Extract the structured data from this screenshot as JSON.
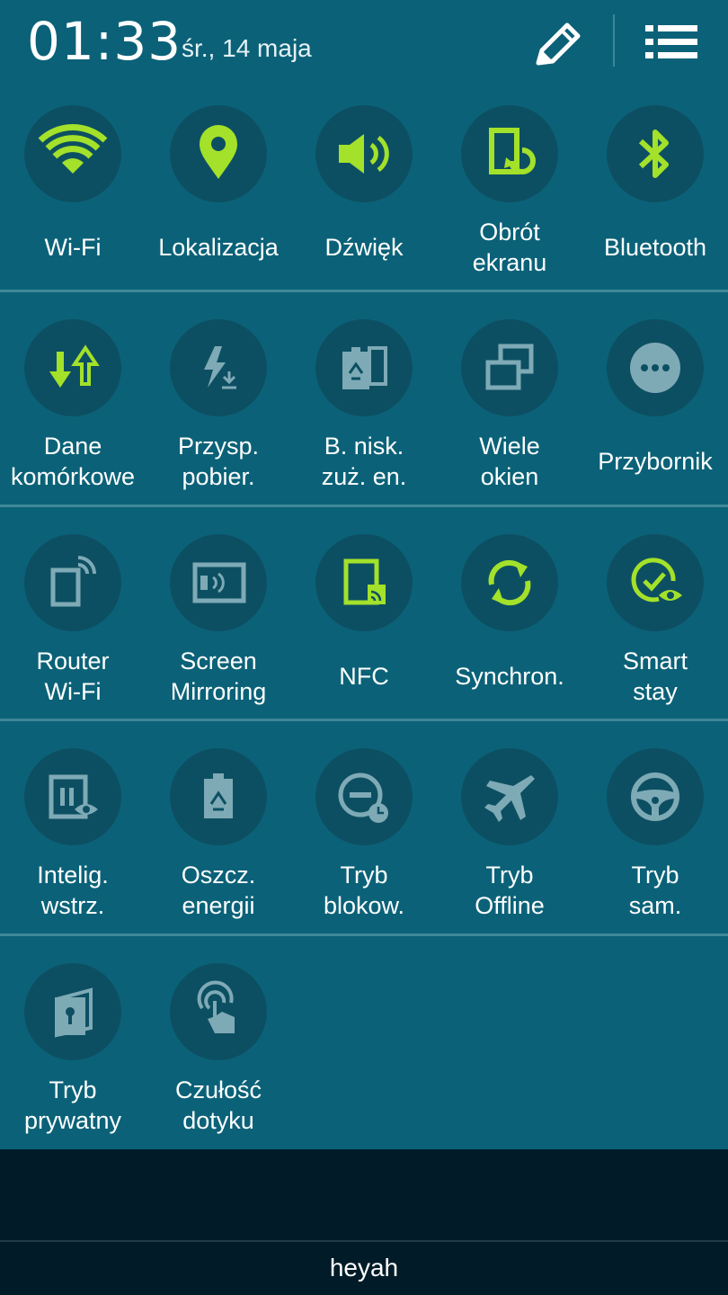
{
  "status": {
    "time": "01:33",
    "date": "śr., 14 maja"
  },
  "header": {
    "edit_icon": "pencil-icon",
    "menu_icon": "list-icon"
  },
  "colors": {
    "panel": "#0b6278",
    "circle": "#0d4f62",
    "active": "#a3e12a",
    "inactive": "#7eaab6"
  },
  "tiles": [
    {
      "label": "Wi-Fi",
      "icon": "wifi-icon",
      "active": true
    },
    {
      "label": "Lokalizacja",
      "icon": "location-pin-icon",
      "active": true
    },
    {
      "label": "Dźwięk",
      "icon": "speaker-icon",
      "active": true
    },
    {
      "label": "Obrót\nekranu",
      "icon": "screen-rotation-icon",
      "active": true
    },
    {
      "label": "Bluetooth",
      "icon": "bluetooth-icon",
      "active": true
    },
    {
      "label": "Dane\nkomórkowe",
      "icon": "mobile-data-arrows-icon",
      "active": true
    },
    {
      "label": "Przysp.\npobier.",
      "icon": "download-booster-icon",
      "active": false
    },
    {
      "label": "B. nisk.\nzuż. en.",
      "icon": "battery-recycle-icon",
      "active": false
    },
    {
      "label": "Wiele\nokien",
      "icon": "multi-window-icon",
      "active": false
    },
    {
      "label": "Przybornik",
      "icon": "toolbox-dots-icon",
      "active": false
    },
    {
      "label": "Router\nWi-Fi",
      "icon": "wifi-router-icon",
      "active": false
    },
    {
      "label": "Screen\nMirroring",
      "icon": "screen-mirroring-icon",
      "active": false
    },
    {
      "label": "NFC",
      "icon": "nfc-icon",
      "active": true
    },
    {
      "label": "Synchron.",
      "icon": "sync-icon",
      "active": true
    },
    {
      "label": "Smart\nstay",
      "icon": "smart-stay-eye-icon",
      "active": true
    },
    {
      "label": "Intelig.\nwstrz.",
      "icon": "smart-pause-icon",
      "active": false
    },
    {
      "label": "Oszcz.\nenergii",
      "icon": "power-saving-icon",
      "active": false
    },
    {
      "label": "Tryb\nblokow.",
      "icon": "blocking-mode-icon",
      "active": false
    },
    {
      "label": "Tryb\nOffline",
      "icon": "airplane-icon",
      "active": false
    },
    {
      "label": "Tryb\nsam.",
      "icon": "steering-wheel-icon",
      "active": false
    },
    {
      "label": "Tryb\nprywatny",
      "icon": "private-mode-lock-icon",
      "active": false
    },
    {
      "label": "Czułość\ndotyku",
      "icon": "touch-sensitivity-icon",
      "active": false
    }
  ],
  "carrier": "heyah"
}
